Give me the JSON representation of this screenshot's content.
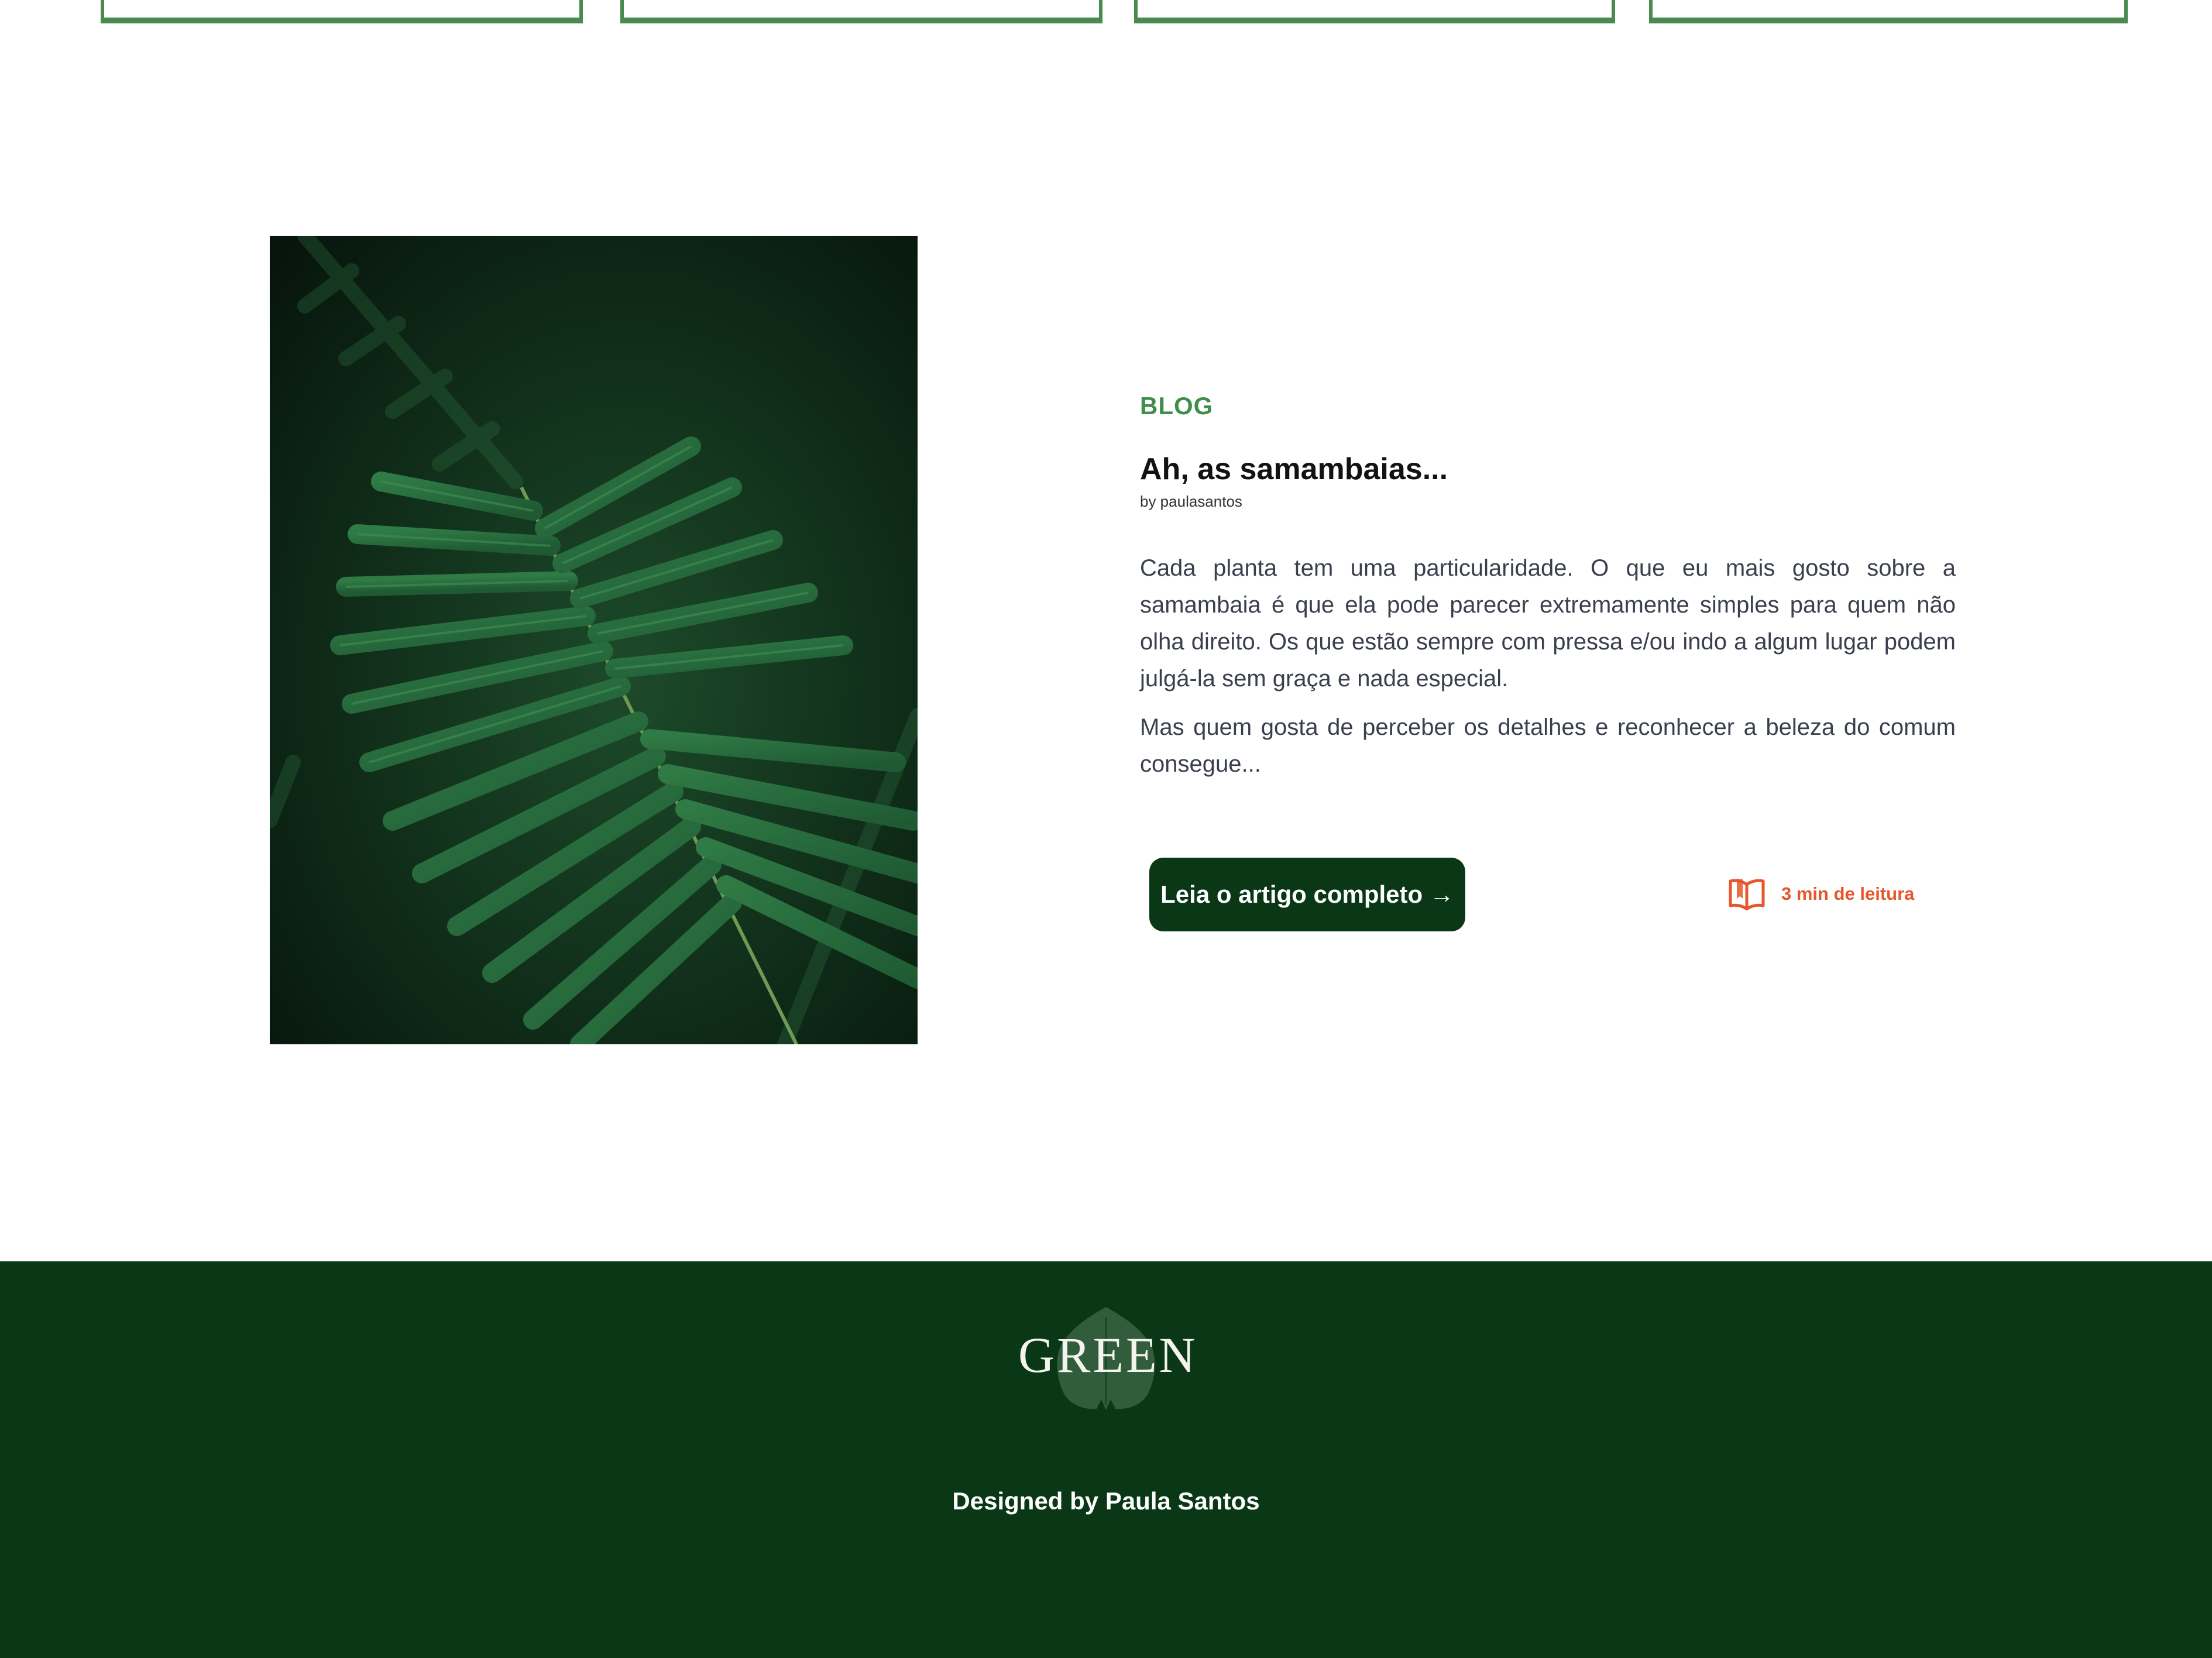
{
  "article": {
    "category": "BLOG",
    "title": "Ah, as samambaias...",
    "byline": "by paulasantos",
    "paragraphs": [
      "Cada planta tem uma particularidade. O que eu mais gosto sobre a samambaia é que ela pode parecer extremamente simples para quem não olha direito. Os que estão sempre com pressa e/ou indo a algum lugar podem julgá-la sem graça e nada especial.",
      "Mas quem gosta de perceber os detalhes e reconhecer a beleza do comum consegue..."
    ],
    "cta_label": "Leia o artigo completo →",
    "read_time": "3 min de leitura",
    "read_time_icon": "open-book-icon",
    "image_icon": "fern-photo"
  },
  "footer": {
    "logo_text": "GREEN",
    "logo_icon": "monstera-leaf-icon",
    "credit": "Designed by Paula Santos"
  },
  "colors": {
    "brand_dark_green": "#0a3817",
    "accent_green": "#3f8f4a",
    "card_border": "#4a8a4f",
    "read_time_orange": "#e8552c",
    "body_text": "#3a3f4d"
  }
}
